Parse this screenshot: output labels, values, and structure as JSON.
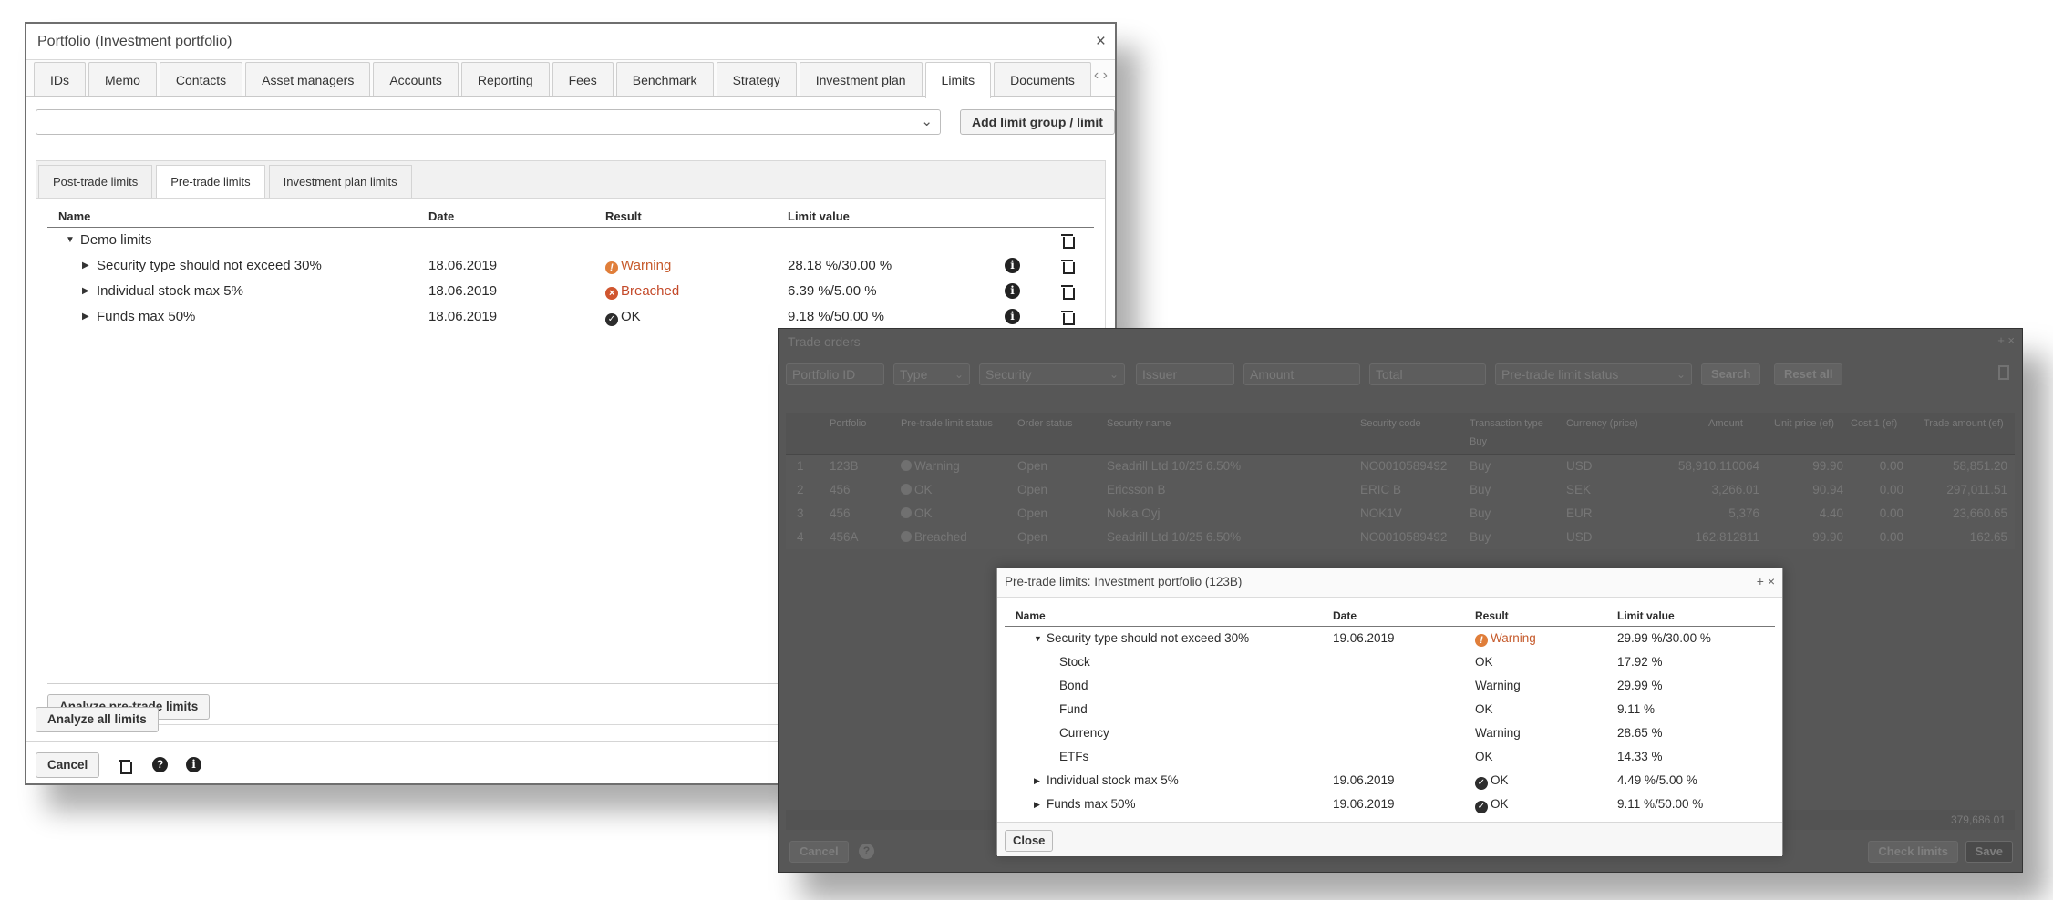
{
  "portfolio_window": {
    "title": "Portfolio (Investment portfolio)",
    "close": "×",
    "tabs": [
      "IDs",
      "Memo",
      "Contacts",
      "Asset managers",
      "Accounts",
      "Reporting",
      "Fees",
      "Benchmark",
      "Strategy",
      "Investment plan",
      "Limits",
      "Documents"
    ],
    "active_tab": "Limits",
    "tab_nav": "‹ ›",
    "add_button": "Add limit group / limit",
    "subtabs": [
      "Post-trade limits",
      "Pre-trade limits",
      "Investment plan limits"
    ],
    "columns": {
      "name": "Name",
      "date": "Date",
      "result": "Result",
      "limit_value": "Limit value"
    },
    "group": "Demo limits",
    "rows": [
      {
        "name": "Security type should not exceed 30%",
        "date": "18.06.2019",
        "result": "Warning",
        "limit": "28.18 %/30.00 %"
      },
      {
        "name": "Individual stock max 5%",
        "date": "18.06.2019",
        "result": "Breached",
        "limit": "6.39 %/5.00 %"
      },
      {
        "name": "Funds max 50%",
        "date": "18.06.2019",
        "result": "OK",
        "limit": "9.18 %/50.00 %"
      }
    ],
    "analyze_pretrade": "Analyze pre-trade limits",
    "analyze_all": "Analyze all limits",
    "cancel": "Cancel",
    "info_glyph": "i",
    "help_glyph": "?"
  },
  "trade_window": {
    "title": "Trade orders",
    "controls": "+ ×",
    "filters": {
      "portfolio_id": "Portfolio ID",
      "type": "Type",
      "security": "Security",
      "issuer": "Issuer",
      "amount": "Amount",
      "total": "Total",
      "status": "Pre-trade limit status"
    },
    "search": "Search",
    "reset": "Reset all",
    "headers": [
      "Portfolio",
      "Pre-trade limit status",
      "Order status",
      "Security name",
      "Security code",
      "Transaction type",
      "Currency (price)",
      "Amount",
      "Unit price (ef)",
      "Cost 1 (ef)",
      "Trade amount (ef)"
    ],
    "type_filter_value": "Buy",
    "rows": [
      {
        "n": "1",
        "portfolio": "123B",
        "status": "Warning",
        "order": "Open",
        "security": "Seadrill Ltd 10/25 6.50%",
        "code": "NO0010589492",
        "type": "Buy",
        "currency": "USD",
        "amount": "58,910.110064",
        "unit": "99.90",
        "cost": "0.00",
        "trade": "58,851.20"
      },
      {
        "n": "2",
        "portfolio": "456",
        "status": "OK",
        "order": "Open",
        "security": "Ericsson B",
        "code": "ERIC B",
        "type": "Buy",
        "currency": "SEK",
        "amount": "3,266.01",
        "unit": "90.94",
        "cost": "0.00",
        "trade": "297,011.51"
      },
      {
        "n": "3",
        "portfolio": "456",
        "status": "OK",
        "order": "Open",
        "security": "Nokia Oyj",
        "code": "NOK1V",
        "type": "Buy",
        "currency": "EUR",
        "amount": "5,376",
        "unit": "4.40",
        "cost": "0.00",
        "trade": "23,660.65"
      },
      {
        "n": "4",
        "portfolio": "456A",
        "status": "Breached",
        "order": "Open",
        "security": "Seadrill Ltd 10/25 6.50%",
        "code": "NO0010589492",
        "type": "Buy",
        "currency": "USD",
        "amount": "162.812811",
        "unit": "99.90",
        "cost": "0.00",
        "trade": "162.65"
      }
    ],
    "total": "379,686.01",
    "cancel": "Cancel",
    "check_limits": "Check limits",
    "save": "Save"
  },
  "popup": {
    "title": "Pre-trade limits: Investment portfolio (123B)",
    "controls": "+ ×",
    "columns": {
      "name": "Name",
      "date": "Date",
      "result": "Result",
      "limit_value": "Limit value"
    },
    "rows": [
      {
        "name": "Security type should not exceed 30%",
        "date": "19.06.2019",
        "result": "Warning",
        "limit": "29.99 %/30.00 %",
        "expanded": true
      },
      {
        "name": "Stock",
        "date": "",
        "result": "OK",
        "limit": "17.92 %"
      },
      {
        "name": "Bond",
        "date": "",
        "result": "Warning",
        "limit": "29.99 %"
      },
      {
        "name": "Fund",
        "date": "",
        "result": "OK",
        "limit": "9.11 %"
      },
      {
        "name": "Currency",
        "date": "",
        "result": "Warning",
        "limit": "28.65 %"
      },
      {
        "name": "ETFs",
        "date": "",
        "result": "OK",
        "limit": "14.33 %"
      },
      {
        "name": "Individual stock max 5%",
        "date": "19.06.2019",
        "result": "OK",
        "limit": "4.49 %/5.00 %"
      },
      {
        "name": "Funds max 50%",
        "date": "19.06.2019",
        "result": "OK",
        "limit": "9.11 %/50.00 %"
      }
    ],
    "close": "Close"
  },
  "colors": {
    "warning": "#e07e3a",
    "breached": "#d0562f",
    "dark_window": "#575757"
  }
}
